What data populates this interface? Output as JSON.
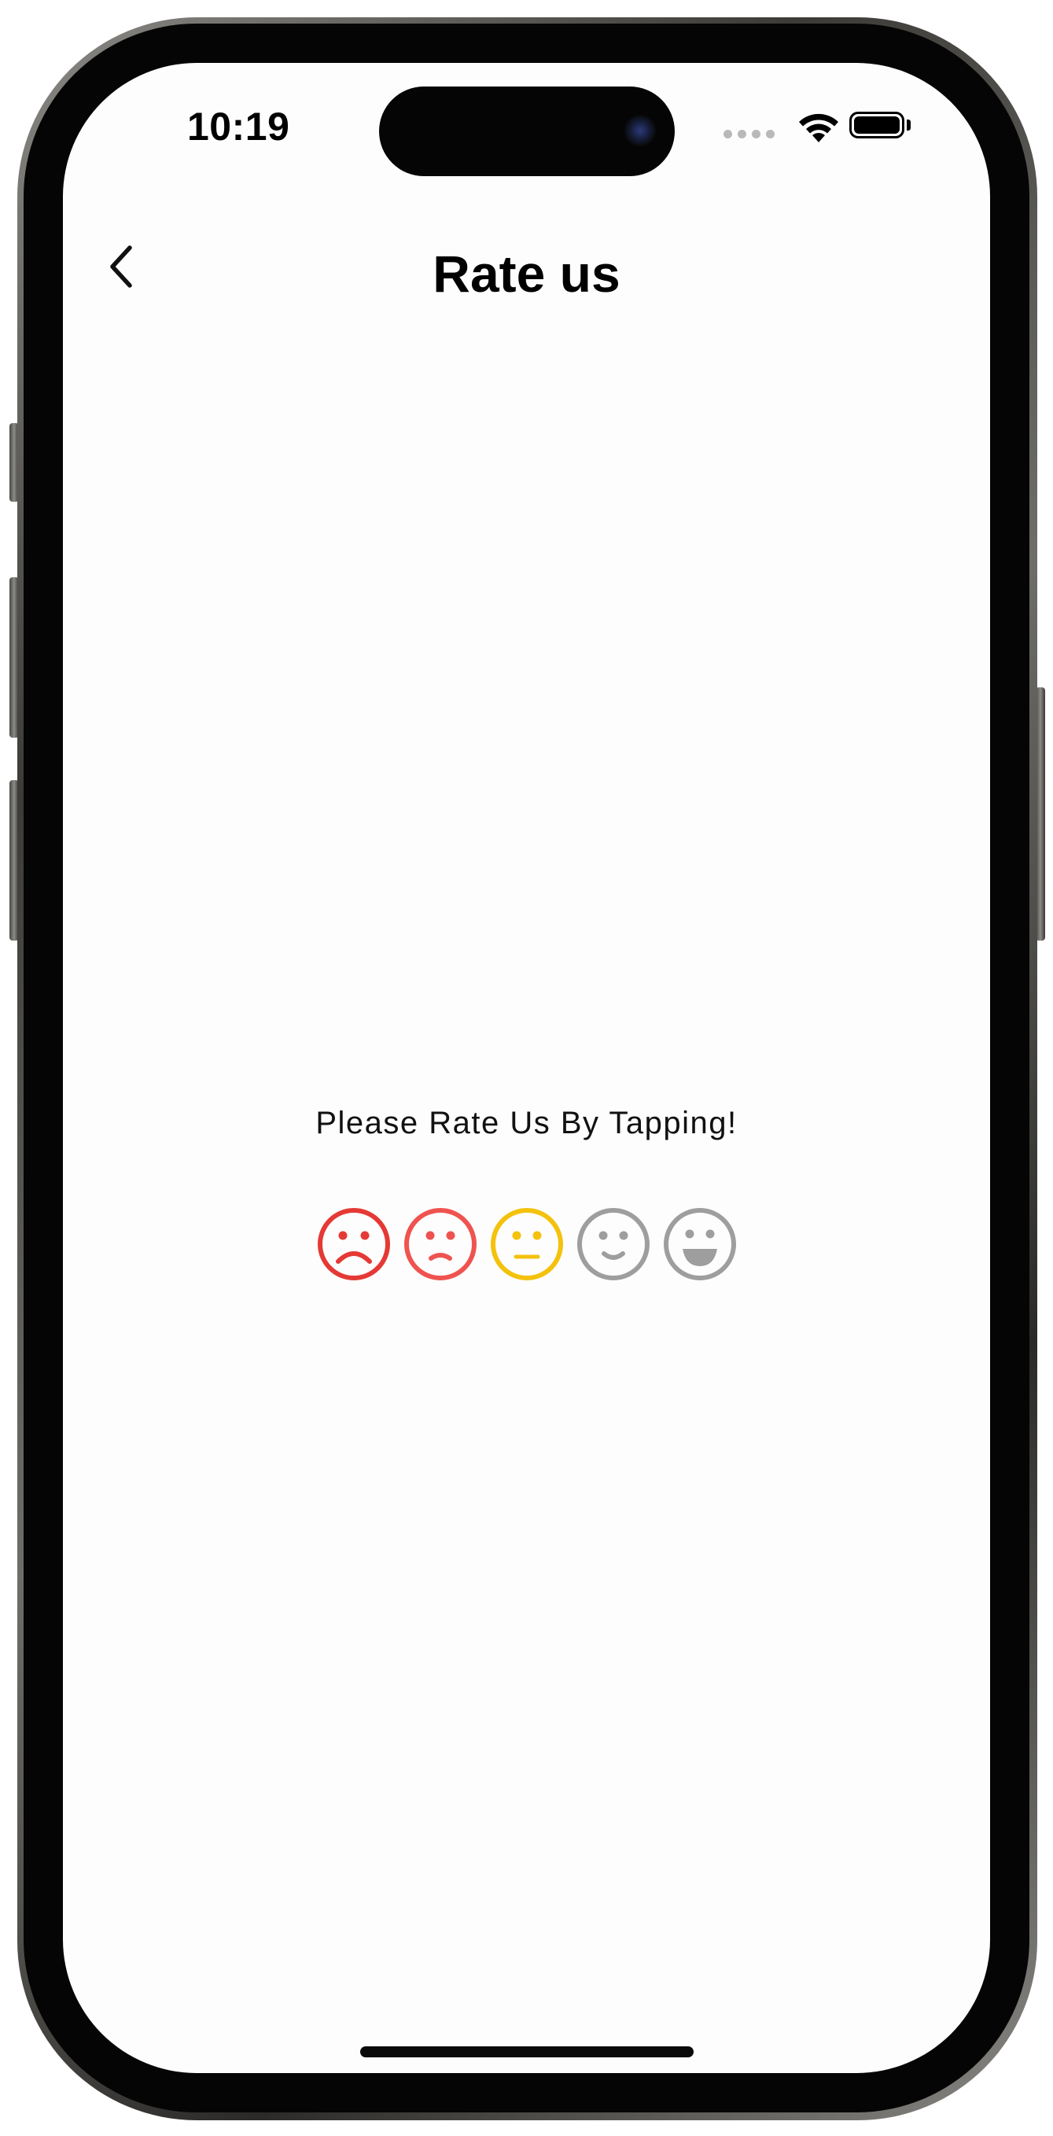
{
  "status_bar": {
    "time": "10:19"
  },
  "nav": {
    "back_icon": "chevron-left-icon",
    "title": "Rate us"
  },
  "rating": {
    "prompt": "Please Rate Us By Tapping!",
    "faces": [
      {
        "icon": "very-sad-face-icon",
        "color": "#e53935"
      },
      {
        "icon": "sad-face-icon",
        "color": "#ef5350"
      },
      {
        "icon": "neutral-face-icon",
        "color": "#f4c20d"
      },
      {
        "icon": "happy-face-icon",
        "color": "#9e9e9e"
      },
      {
        "icon": "very-happy-face-icon",
        "color": "#9e9e9e"
      }
    ]
  }
}
